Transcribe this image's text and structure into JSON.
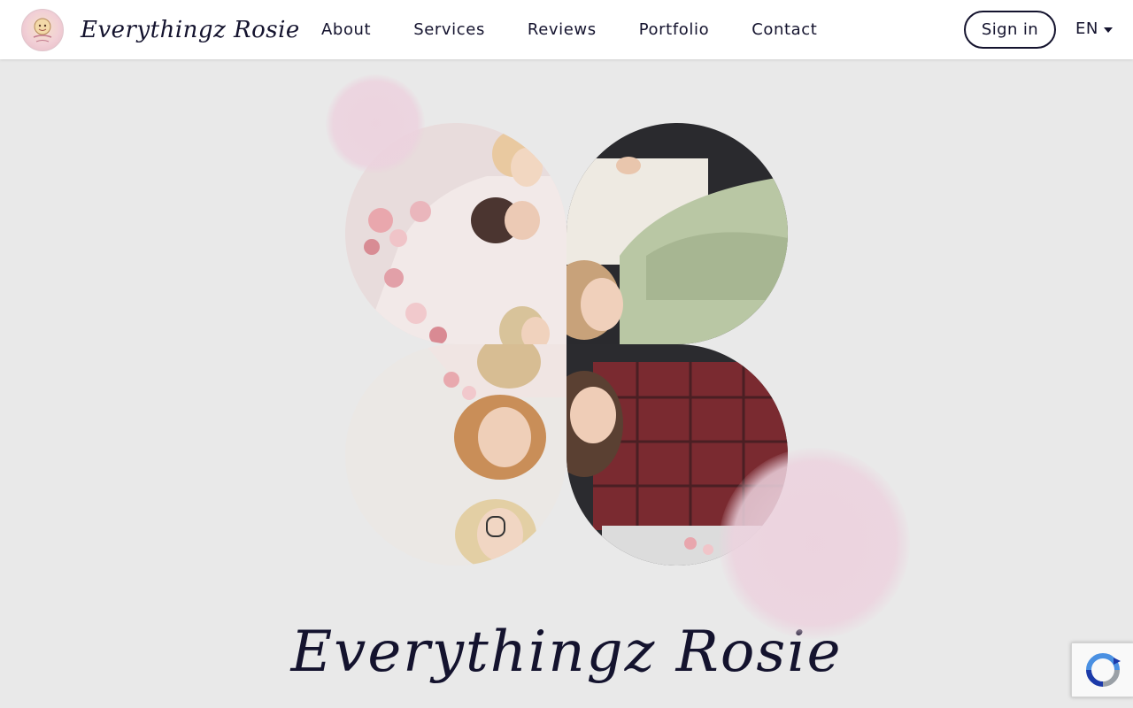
{
  "header": {
    "brand_name": "Everythingz Rosie",
    "logo_badge_text": "Everythingz Rosie",
    "nav": [
      {
        "label": "About"
      },
      {
        "label": "Services"
      },
      {
        "label": "Reviews"
      },
      {
        "label": "Portfolio"
      },
      {
        "label": "Contact"
      }
    ],
    "sign_in_label": "Sign in",
    "language": "EN"
  },
  "hero": {
    "title": "Everythingz Rosie",
    "collage_photos": [
      {
        "alt": "group-photo-top-left"
      },
      {
        "alt": "group-photo-top-right"
      },
      {
        "alt": "group-photo-bottom-left"
      },
      {
        "alt": "group-photo-bottom-right"
      }
    ]
  },
  "colors": {
    "text": "#14132e",
    "page_bg": "#e9e9e9",
    "header_bg": "#ffffff",
    "accent_pink": "#ecd2de"
  },
  "icons": [
    "logo-badge-icon",
    "caret-down-icon",
    "recaptcha-icon"
  ]
}
